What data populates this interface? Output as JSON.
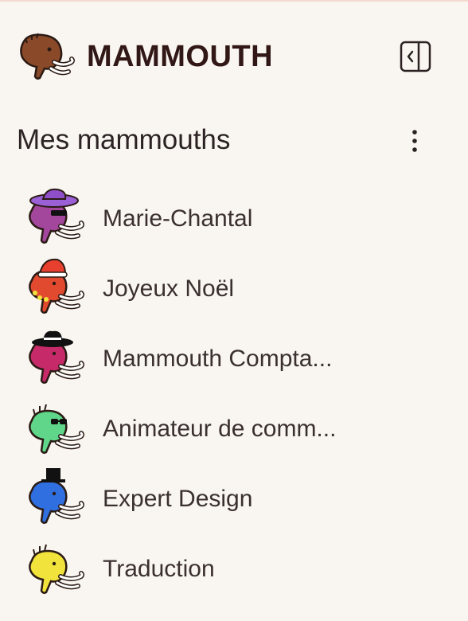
{
  "header": {
    "brand": "MAMMOUTH",
    "logo_icon": "mammoth-logo-icon",
    "toggle_icon": "sidebar-collapse-icon"
  },
  "section": {
    "title": "Mes mammouths",
    "menu_icon": "more-vertical-icon"
  },
  "colors": {
    "background": "#f9f5f0",
    "brand_text": "#311816",
    "logo": "#8a4a2a"
  },
  "mammoths": [
    {
      "label": "Marie-Chantal",
      "color": "#a3479d",
      "accessory": "wide-hat-sunglasses"
    },
    {
      "label": "Joyeux Noël",
      "color": "#e24a2f",
      "accessory": "santa-hat"
    },
    {
      "label": "Mammouth Compta...",
      "color": "#c62a68",
      "accessory": "fedora"
    },
    {
      "label": "Animateur de comm...",
      "color": "#5fd689",
      "accessory": "sunglasses"
    },
    {
      "label": "Expert Design",
      "color": "#2f6fe0",
      "accessory": "top-hat"
    },
    {
      "label": "Traduction",
      "color": "#f1e33c",
      "accessory": "none"
    }
  ]
}
